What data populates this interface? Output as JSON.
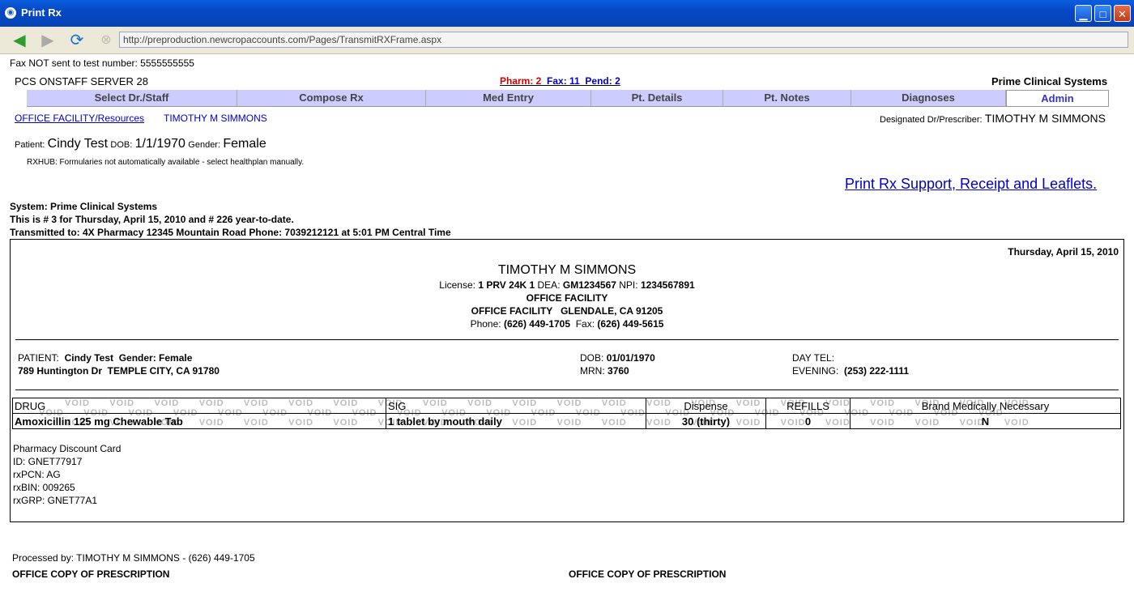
{
  "window": {
    "title": "Print Rx"
  },
  "browser": {
    "url": "http://preproduction.newcropaccounts.com/Pages/TransmitRXFrame.aspx"
  },
  "notice": "Fax NOT sent to test number: 5555555555",
  "header": {
    "server": "PCS ONSTAFF SERVER 28",
    "pharm": "Pharm: 2",
    "fax": "Fax: 11",
    "pend": "Pend: 2",
    "company": "Prime Clinical Systems"
  },
  "tabs": [
    "Select Dr./Staff",
    "Compose Rx",
    "Med Entry",
    "Pt. Details",
    "Pt. Notes",
    "Diagnoses",
    "Admin"
  ],
  "context": {
    "facility_link": "OFFICE FACILITY/Resources",
    "doctor_link": "TIMOTHY M SIMMONS",
    "designated_label": "Designated Dr/Prescriber:",
    "designated_value": "TIMOTHY M SIMMONS"
  },
  "patient_bar": {
    "patient_label": "Patient:",
    "patient_value": "Cindy Test",
    "dob_label": "DOB:",
    "dob_value": "1/1/1970",
    "gender_label": "Gender:",
    "gender_value": "Female",
    "rxhub": "RXHUB: Formularies not automatically available - select healthplan manually."
  },
  "support_link": "Print Rx Support, Receipt and Leaflets.",
  "system": {
    "line1": "System: Prime Clinical Systems",
    "line2": "This is # 3 for Thursday, April 15, 2010 and # 226 year-to-date.",
    "line3": "Transmitted to: 4X Pharmacy 12345 Mountain Road Phone: 7039212121 at 5:01 PM Central Time"
  },
  "rx": {
    "date": "Thursday, April 15, 2010",
    "prescriber": "TIMOTHY M SIMMONS",
    "license_label": "License:",
    "license_value": "1 PRV 24K 1",
    "dea_label": "DEA:",
    "dea_value": "GM1234567",
    "npi_label": "NPI:",
    "npi_value": "1234567891",
    "facility": "OFFICE FACILITY",
    "address": "OFFICE FACILITY   GLENDALE, CA 91205",
    "phone_label": "Phone:",
    "phone_value": "(626) 449-1705",
    "fax_label": "Fax:",
    "fax_value": "(626) 449-5615",
    "patient_label": "PATIENT:",
    "patient_value": "Cindy Test  Gender: Female",
    "patient_address": "789 Huntington Dr  TEMPLE CITY, CA 91780",
    "dob_label": "DOB:",
    "dob_value": "01/01/1970",
    "mrn_label": "MRN:",
    "mrn_value": "3760",
    "daytel_label": "DAY TEL:",
    "evening_label": "EVENING:",
    "evening_value": "(253) 222-1111",
    "columns": {
      "drug": "DRUG",
      "sig": "SIG",
      "dispense": "Dispense",
      "refills": "REFILLS",
      "brand": "Brand Medically Necessary"
    },
    "row": {
      "drug": "Amoxicillin 125 mg Chewable Tab",
      "sig": "1 tablet by mouth daily",
      "dispense": "30 (thirty)",
      "refills": "0",
      "brand": "N"
    },
    "void_word": "VOID",
    "discount": {
      "title": "Pharmacy Discount Card",
      "id": "ID: GNET77917",
      "pcn": "rxPCN: AG",
      "bin": "rxBIN: 009265",
      "grp": "rxGRP: GNET77A1"
    }
  },
  "footer": {
    "processed": "Processed by: TIMOTHY M SIMMONS - (626) 449-1705",
    "copy_left": "OFFICE COPY OF PRESCRIPTION",
    "copy_right": "OFFICE COPY OF PRESCRIPTION"
  }
}
